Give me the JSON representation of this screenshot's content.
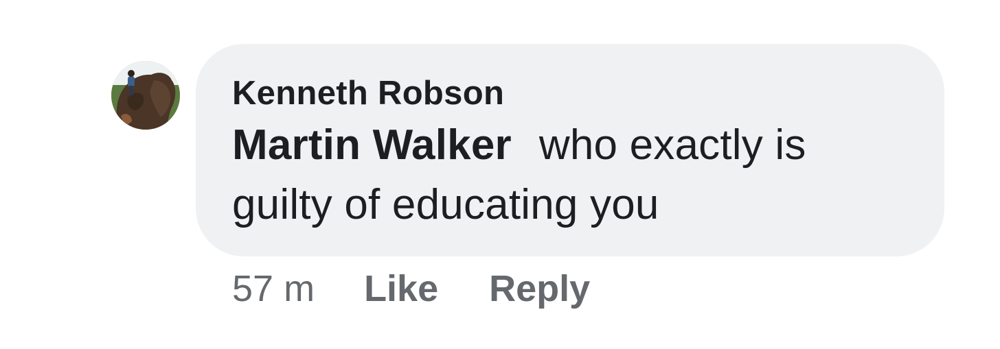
{
  "comment": {
    "author": "Kenneth Robson",
    "mention": "Martin Walker",
    "text_line1": "who exactly is",
    "text_line2": "guilty of educating you",
    "timestamp": "57 m",
    "like_label": "Like",
    "reply_label": "Reply"
  },
  "colors": {
    "bubble_background": "#f0f1f3",
    "text": "#1c1e21",
    "secondary_text": "#65686c"
  }
}
